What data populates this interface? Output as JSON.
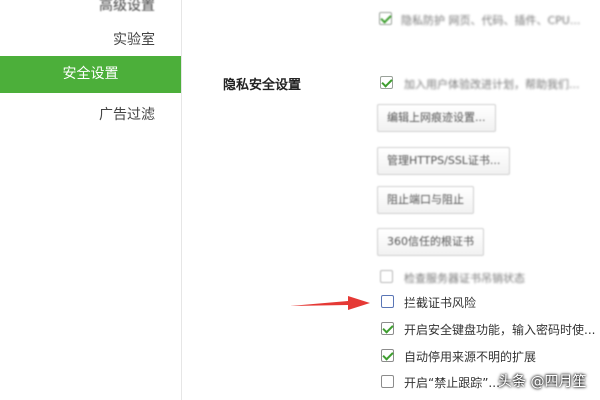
{
  "sidebar": {
    "items": [
      {
        "label": "高级设置"
      },
      {
        "label": "实验室"
      },
      {
        "label": "安全设置",
        "active": true
      },
      {
        "label": "广告过滤"
      }
    ]
  },
  "top_option": {
    "label": "隐私防护  网页、代码、插件、CPU..."
  },
  "section": {
    "title": "隐私安全设置"
  },
  "options": {
    "join_plan": "加入用户体验改进计划，帮助我们...",
    "check_revocation": "检查服务器证书吊销状态",
    "block_cert_risk": "拦截证书风险",
    "secure_keyboard": "开启安全键盘功能，输入密码时使...",
    "auto_disable_ext": "自动停用来源不明的扩展",
    "do_not_track": "开启“禁止跟踪”..."
  },
  "buttons": {
    "web_access": "编辑上网痕迹设置...",
    "manage_certs": "管理HTTPS/SSL证书...",
    "block_ports": "阻止端口与阻止",
    "cert_360": "360信任的根证书"
  },
  "watermark": "头条 @四月笙",
  "colors": {
    "accent": "#4caf3a",
    "arrow": "#e53935"
  }
}
